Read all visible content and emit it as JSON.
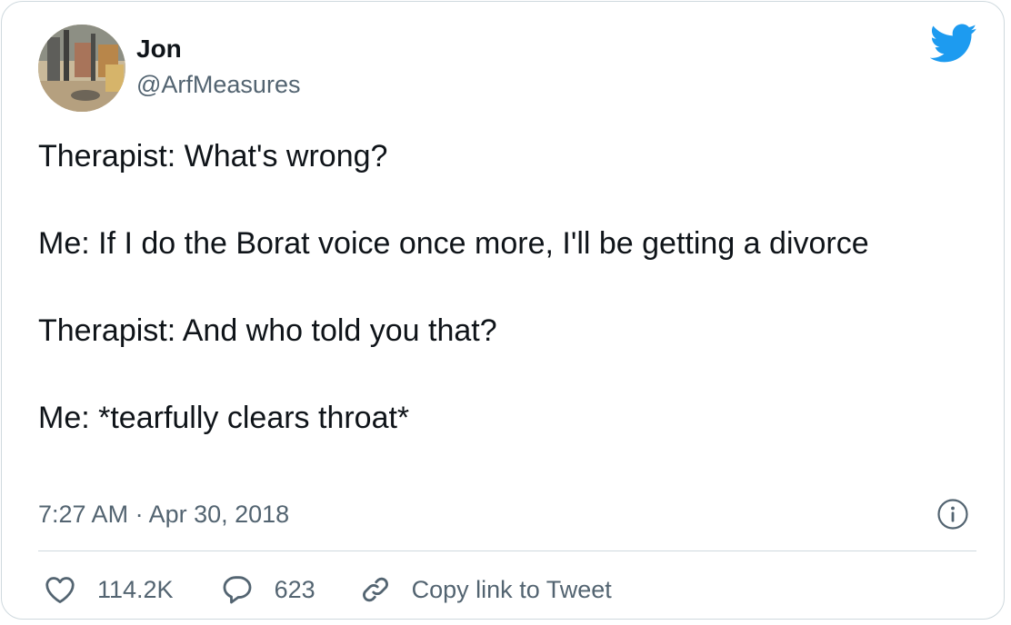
{
  "tweet": {
    "author": {
      "name": "Jon",
      "handle": "@ArfMeasures",
      "avatar_icon": "profile-photo"
    },
    "lines": [
      "Therapist: What's wrong?",
      "Me: If I do the Borat voice once more, I'll be getting a divorce",
      "Therapist: And who told you that?",
      "Me: *tearfully clears throat*"
    ],
    "timestamp": "7:27 AM · Apr 30, 2018"
  },
  "actions": {
    "like_count": "114.2K",
    "reply_count": "623",
    "copy_link_label": "Copy link to Tweet"
  },
  "icons": {
    "brand": "twitter-bird-icon",
    "info": "info-icon",
    "like": "heart-icon",
    "reply": "speech-bubble-icon",
    "link": "link-icon"
  },
  "colors": {
    "brand_blue": "#1d9bf0",
    "text_primary": "#0f1419",
    "text_secondary": "#536471",
    "border": "#cfd9de"
  }
}
